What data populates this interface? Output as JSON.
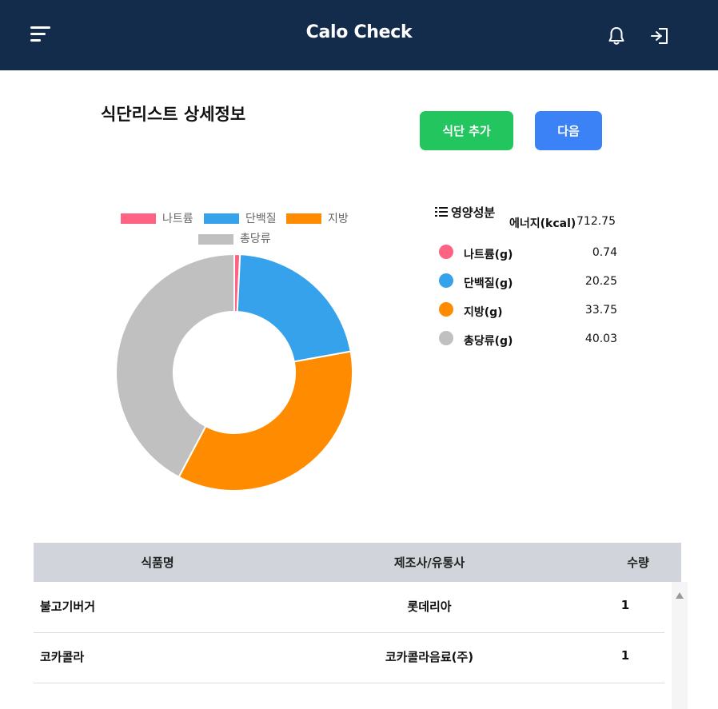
{
  "header": {
    "title": "Calo Check",
    "menu_icon": "hamburger-menu-icon",
    "notification_icon": "bell-icon",
    "logout_icon": "logout-icon",
    "background": "#132c4c"
  },
  "page": {
    "title": "식단리스트 상세정보",
    "add_button_label": "식단 추가",
    "next_button_label": "다음",
    "add_button_color": "#22c55e",
    "next_button_color": "#3b82f6"
  },
  "chart_data": {
    "type": "pie",
    "variant": "doughnut",
    "categories": [
      "나트륨",
      "단백질",
      "지방",
      "총당류"
    ],
    "values": [
      0.74,
      20.25,
      33.75,
      40.03
    ],
    "colors": [
      "#ff6384",
      "#36a2eb",
      "#ff8c00",
      "#c0c0c0"
    ],
    "legend_position": "top"
  },
  "nutrition": {
    "heading": "영양성분",
    "energy_label": "에너지(kcal)",
    "energy_value": "712.75",
    "items": [
      {
        "name": "나트륨(g)",
        "value": "0.74",
        "color": "#ff6384"
      },
      {
        "name": "단백질(g)",
        "value": "20.25",
        "color": "#36a2eb"
      },
      {
        "name": "지방(g)",
        "value": "33.75",
        "color": "#ff8c00"
      },
      {
        "name": "총당류(g)",
        "value": "40.03",
        "color": "#c0c0c0"
      }
    ]
  },
  "table": {
    "columns": [
      "식품명",
      "제조사/유통사",
      "수량"
    ],
    "rows": [
      {
        "name": "불고기버거",
        "maker": "롯데리아",
        "qty": "1"
      },
      {
        "name": "코카콜라",
        "maker": "코카콜라음료(주)",
        "qty": "1"
      }
    ]
  }
}
